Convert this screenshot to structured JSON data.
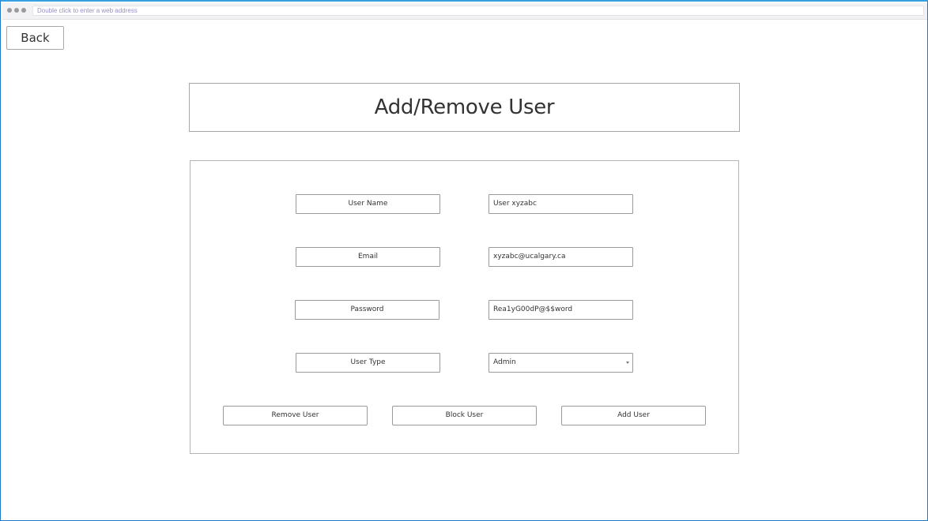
{
  "browser": {
    "address_placeholder": "Double click to enter a web address"
  },
  "nav": {
    "back_label": "Back"
  },
  "page": {
    "title": "Add/Remove User"
  },
  "form": {
    "fields": [
      {
        "label": "User Name",
        "value": "User xyzabc"
      },
      {
        "label": "Email",
        "value": "xyzabc@ucalgary.ca"
      },
      {
        "label": "Password",
        "value": "Rea1yG00dP@$$word"
      },
      {
        "label": "User Type",
        "value": "Admin",
        "options": [
          "Admin"
        ]
      }
    ],
    "buttons": {
      "remove": "Remove User",
      "block": "Block User",
      "add": "Add User"
    }
  },
  "colors": {
    "frame_accent": "#1f78c8",
    "border": "#9a9a9a",
    "text": "#333333"
  }
}
